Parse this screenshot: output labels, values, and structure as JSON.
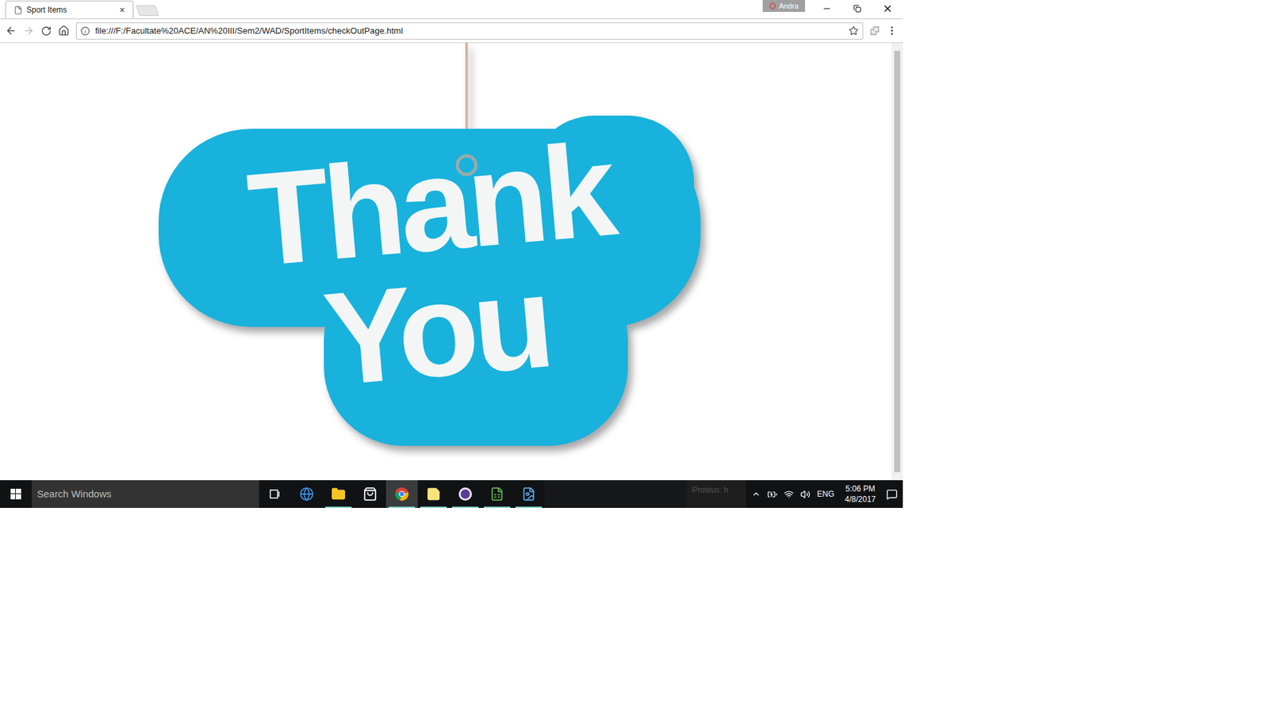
{
  "window": {
    "tab_title": "Sport Items",
    "tab_close": "×",
    "profile": "Andra"
  },
  "address_bar": {
    "url": "file:///F:/Facultate%20ACE/AN%20III/Sem2/WAD/SportItems/checkOutPage.html"
  },
  "page": {
    "graphic_lines": [
      "Thank",
      "You"
    ]
  },
  "taskbar": {
    "search_placeholder": "Search Windows",
    "apps": [
      {
        "kind": "taskview",
        "running": false,
        "selected": false
      },
      {
        "kind": "edge",
        "running": false,
        "selected": false
      },
      {
        "kind": "explorer",
        "running": true,
        "selected": false
      },
      {
        "kind": "store",
        "running": false,
        "selected": false
      },
      {
        "kind": "chrome",
        "running": true,
        "selected": true
      },
      {
        "kind": "sticky",
        "running": true,
        "selected": false
      },
      {
        "kind": "purple",
        "running": true,
        "selected": false
      },
      {
        "kind": "spreadsheet",
        "running": true,
        "selected": false
      },
      {
        "kind": "image",
        "running": true,
        "selected": false
      }
    ],
    "notification": "Proteus: h",
    "language": "ENG",
    "time": "5:06 PM",
    "date": "4/8/2017"
  }
}
